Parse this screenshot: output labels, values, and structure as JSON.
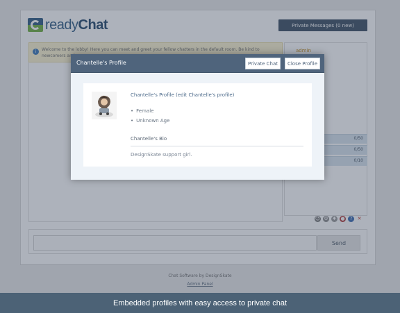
{
  "app": {
    "logo_ready": "ready",
    "logo_chat": "Chat"
  },
  "header": {
    "private_messages_label": "Private Messages (0 new)"
  },
  "welcome": {
    "text": "Welcome to the lobby! Here you can meet and greet your fellow chatters in the default room. Be kind to newcomers and"
  },
  "sidebar": {
    "users": [
      "admin"
    ],
    "rooms": [
      {
        "name": "",
        "count": "0/50"
      },
      {
        "name": "om",
        "count": "0/50"
      },
      {
        "name": "",
        "count": "0/10"
      }
    ]
  },
  "composer": {
    "send_label": "Send"
  },
  "footer": {
    "credit": "Chat Software by DesignSkate",
    "admin_link": "Admin Panel"
  },
  "modal": {
    "title": "Chantelle's Profile",
    "private_chat_label": "Private Chat",
    "close_profile_label": "Close Profile",
    "profile_heading": "Chantelle's Profile (edit Chantelle's profile)",
    "details": [
      "Female",
      "Unknown Age"
    ],
    "bio_label": "Chantelle's Bio",
    "bio_text": "DesignSkate support girl."
  },
  "caption": {
    "text": "Embedded profiles with easy access to private chat"
  },
  "colors": {
    "modal_header": "#4f647c",
    "caption_bar": "#4c6276",
    "pm_button": "#3c4f62",
    "welcome_bg": "#fbf3cf"
  },
  "icons": {
    "toolbar": [
      "smiley-icon",
      "settings-icon",
      "shield-icon",
      "status-icon",
      "help-icon",
      "close-icon"
    ]
  }
}
